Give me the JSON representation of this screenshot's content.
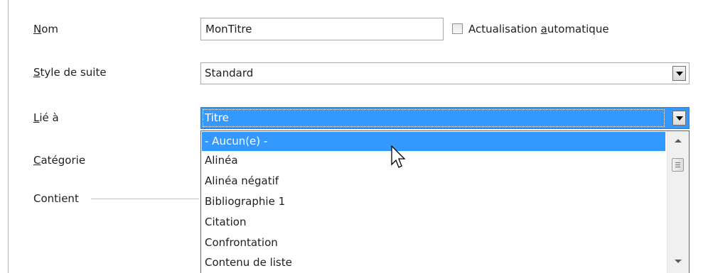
{
  "form": {
    "name_label": "Nom",
    "name_value": "MonTitre",
    "auto_update_label": "Actualisation automatique",
    "auto_update_checked": false,
    "next_style_label": "Style de suite",
    "next_style_value": "Standard",
    "linked_to_label": "Lié à",
    "linked_to_value": "Titre",
    "category_label": "Catégorie",
    "contains_label": "Contient"
  },
  "dropdown": {
    "items": [
      "- Aucun(e) -",
      "Alinéa",
      "Alinéa négatif",
      "Bibliographie 1",
      "Citation",
      "Confrontation",
      "Contenu de liste"
    ],
    "selected_index": 0
  },
  "icons": {
    "combo_arrow": "chevron-down-icon",
    "scroll_up": "scroll-up-icon",
    "scroll_down": "scroll-down-icon",
    "cursor": "mouse-pointer-icon"
  },
  "colors": {
    "selection": "#3399ff",
    "selection_text": "#ffffff",
    "field_border": "#ababab"
  }
}
